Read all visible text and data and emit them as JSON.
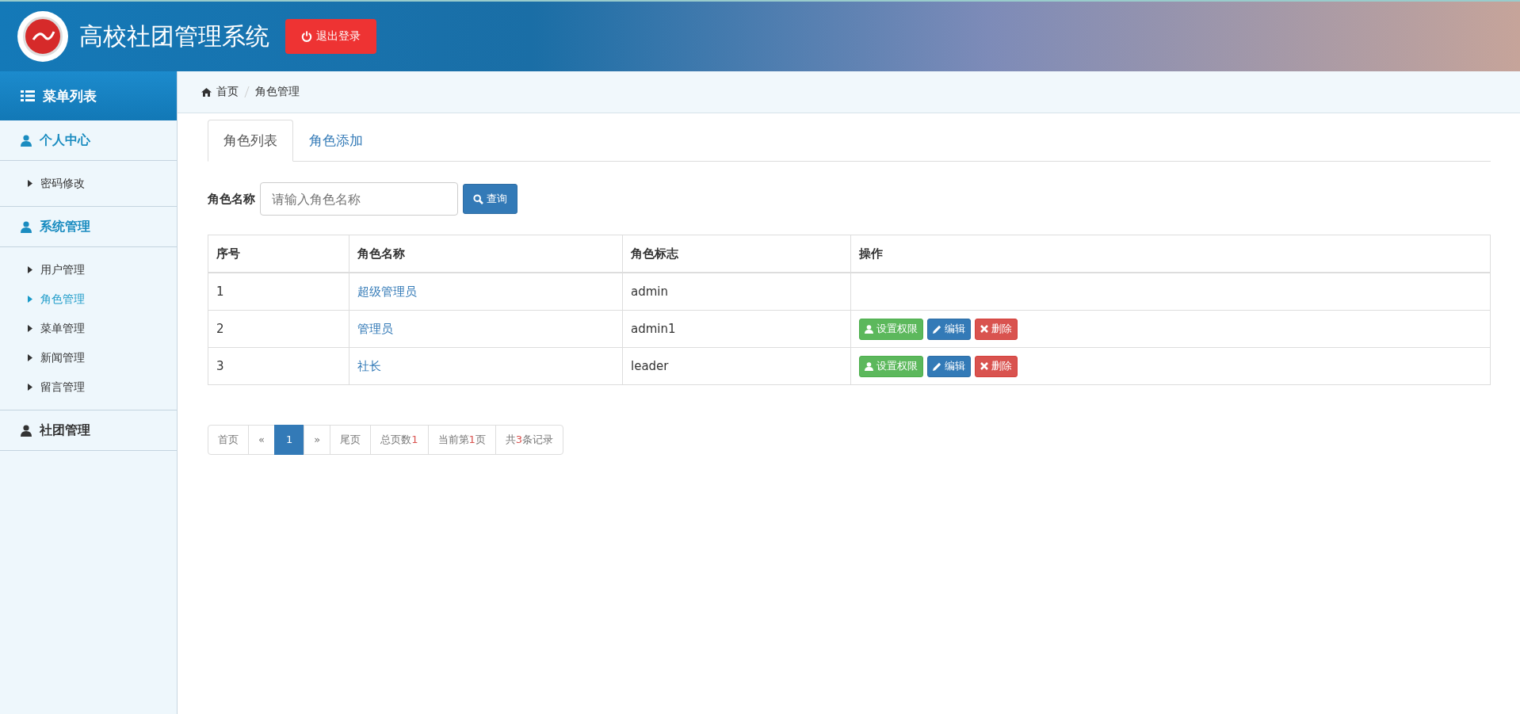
{
  "header": {
    "title": "高校社团管理系统",
    "logout_button": "退出登录"
  },
  "sidebar": {
    "title": "菜单列表",
    "groups": [
      {
        "label": "个人中心",
        "expanded": true,
        "items": [
          {
            "label": "密码修改",
            "selected": false
          }
        ]
      },
      {
        "label": "系统管理",
        "expanded": true,
        "items": [
          {
            "label": "用户管理",
            "selected": false
          },
          {
            "label": "角色管理",
            "selected": true
          },
          {
            "label": "菜单管理",
            "selected": false
          },
          {
            "label": "新闻管理",
            "selected": false
          },
          {
            "label": "留言管理",
            "selected": false
          }
        ]
      },
      {
        "label": "社团管理",
        "expanded": false
      }
    ]
  },
  "breadcrumb": [
    "首页",
    "角色管理"
  ],
  "tabs": [
    {
      "label": "角色列表",
      "selected": true
    },
    {
      "label": "角色添加",
      "selected": false
    }
  ],
  "search": {
    "label": "角色名称",
    "placeholder": "请输入角色名称",
    "button": "查询"
  },
  "table": {
    "columns": [
      "序号",
      "角色名称",
      "角色标志",
      "操作"
    ],
    "rows": [
      {
        "no": "1",
        "name": "超级管理员",
        "code": "admin",
        "actions": []
      },
      {
        "no": "2",
        "name": "管理员",
        "code": "admin1",
        "actions": [
          {
            "kind": "permission",
            "label": "设置权限"
          },
          {
            "kind": "edit",
            "label": "编辑"
          },
          {
            "kind": "delete",
            "label": "删除"
          }
        ]
      },
      {
        "no": "3",
        "name": "社长",
        "code": "leader",
        "actions": [
          {
            "kind": "permission",
            "label": "设置权限"
          },
          {
            "kind": "edit",
            "label": "编辑"
          },
          {
            "kind": "delete",
            "label": "删除"
          }
        ]
      }
    ]
  },
  "pagination": [
    {
      "kind": "link",
      "label": "首页",
      "selected": false
    },
    {
      "kind": "link",
      "label": "«",
      "selected": false
    },
    {
      "kind": "link",
      "label": "1",
      "selected": true
    },
    {
      "kind": "link",
      "label": "»",
      "selected": false
    },
    {
      "kind": "link",
      "label": "尾页",
      "selected": false
    },
    {
      "kind": "info",
      "before": "总页数",
      "number": "1"
    },
    {
      "kind": "info",
      "before": "当前第",
      "number": "1",
      "after": "页"
    },
    {
      "kind": "info",
      "before": "共",
      "number": "3",
      "after": "条记录"
    }
  ]
}
